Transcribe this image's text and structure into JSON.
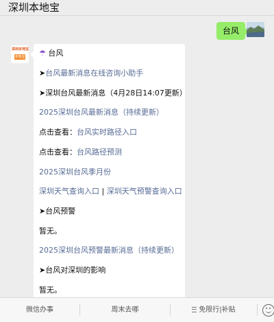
{
  "header": {
    "title": "深圳本地宝"
  },
  "user": {
    "message": "台风"
  },
  "bot": {
    "logo_text": "深圳本地宝",
    "logo_sub": "本地宝",
    "lines": [
      {
        "icon": "umbrella-icon",
        "text": "台风"
      },
      {
        "prefix": "➤",
        "text": "台风最新消息在线咨询小助手",
        "style": "link"
      },
      {
        "prefix": "➤",
        "text": "深圳台风最新消息（4月28日14:07更新）",
        "style": "plain"
      },
      {
        "text": "2025深圳台风最新消息（持续更新）",
        "style": "link"
      },
      {
        "label": "点击查看：",
        "text": "台风实时路径入口",
        "style": "link"
      },
      {
        "label": "点击查看：",
        "text": "台风路径预测",
        "style": "link"
      },
      {
        "text": "2025深圳台风季月份",
        "style": "link"
      },
      {
        "text_a": "深圳天气查询入口",
        "sep": " | ",
        "text_b": "深圳天气预警查询入口",
        "style": "link"
      },
      {
        "prefix": "➤",
        "text": "台风预警",
        "style": "plain"
      },
      {
        "text": "暂无。",
        "style": "plain"
      },
      {
        "text": "2025深圳台风预警最新消息（持续更新）",
        "style": "link"
      },
      {
        "prefix": "➤",
        "text": "台风对深圳的影响",
        "style": "plain"
      },
      {
        "text": "暂无。",
        "style": "plain"
      }
    ]
  },
  "bottom_nav": {
    "tabs": [
      "微信办事",
      "周末去哪",
      "免限行|补贴"
    ]
  },
  "colors": {
    "link": "#576b95",
    "user_bubble": "#95ec69",
    "background": "#ededed"
  }
}
